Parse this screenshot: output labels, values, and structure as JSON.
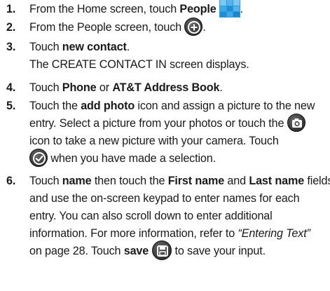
{
  "steps": [
    {
      "number": "1.",
      "parts": [
        "From the Home screen, touch ",
        "People",
        "."
      ]
    },
    {
      "number": "2.",
      "parts": [
        "From the People screen, touch ",
        "."
      ]
    },
    {
      "number": "3.",
      "parts": [
        "Touch ",
        "new contact",
        "."
      ],
      "note": "The CREATE CONTACT IN screen displays."
    },
    {
      "number": "4.",
      "parts": [
        "Touch ",
        "Phone",
        " or ",
        "AT&T Address Book",
        "."
      ]
    },
    {
      "number": "5.",
      "lines": [
        [
          "Touch the ",
          "add photo",
          " icon and assign a picture to the new"
        ],
        [
          "entry. Select a picture from your photos or touch the "
        ],
        [
          "icon to take a new picture with your camera. Touch"
        ],
        [
          " when you have made a selection."
        ]
      ]
    },
    {
      "number": "6.",
      "lines": [
        [
          "Touch ",
          "name",
          " then touch the ",
          "First name",
          " and ",
          "Last name",
          " fields"
        ],
        [
          "and use the on-screen keypad to enter names for each"
        ],
        [
          "entry. You can also scroll down to enter additional"
        ],
        [
          "information. For more information, refer to ",
          "“Entering Text”"
        ],
        [
          "on page 28. Touch ",
          "save",
          " to save your input."
        ]
      ]
    }
  ],
  "icons": {
    "people": "people-tile-icon",
    "add": "plus-circle-icon",
    "camera": "camera-icon",
    "done": "checkmark-circle-icon",
    "save": "save-disk-icon"
  },
  "colors": {
    "text": "#1a1a1a",
    "people_tile_blue": "#2a9de0",
    "people_tile_light": "#7cc8f2",
    "icon_dark": "#3a3a3a"
  }
}
